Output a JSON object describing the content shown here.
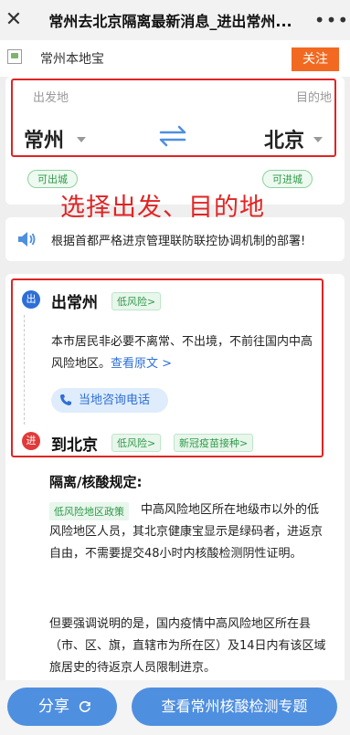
{
  "topbar": {
    "close": "✕",
    "title": "常州去北京隔离最新消息_进出常州...",
    "more": "•••"
  },
  "brand": {
    "name": "常州本地宝",
    "follow": "关注"
  },
  "route": {
    "from_label": "出发地",
    "to_label": "目的地",
    "from_city": "常州",
    "to_city": "北京",
    "from_tag": "可出城",
    "to_tag": "可进城"
  },
  "callout": "选择出发、目的地",
  "notice": {
    "text": "根据首都严格进京管理联防联控协调机制的部署!"
  },
  "policy": {
    "out_badge": "出",
    "out_city": "出常州",
    "out_risk": "低风险>",
    "out_desc": "本市居民非必要不离常、不出境，不前往国内中高风险地区。",
    "out_link": "查看原文 >",
    "phone": "当地咨询电话",
    "in_badge": "进",
    "in_city": "到北京",
    "in_risk": "低风险>",
    "in_vaccine": "新冠疫苗接种>",
    "rule_title": "隔离/核酸规定:",
    "rule_tag": "低风险地区政策",
    "rule_text1": "中高风险地区所在地级市以外的低风险地区人员，其北京健康宝显示是绿码者，进返京自由，不需要提交48小时内核酸检测阴性证明。",
    "rule_text2": "但要强调说明的是，国内疫情中高风险地区所在县（市、区、旗，直辖市为所在区）及14日内有该区域旅居史的待返京人员限制进京。"
  },
  "bottom": {
    "share": "分享",
    "topic": "查看常州核酸检测专题"
  },
  "colors": {
    "accent_blue": "#4f8fe0",
    "follow_orange": "#f26a21",
    "annotation_red": "#e02424",
    "risk_green": "#2f9a48"
  }
}
